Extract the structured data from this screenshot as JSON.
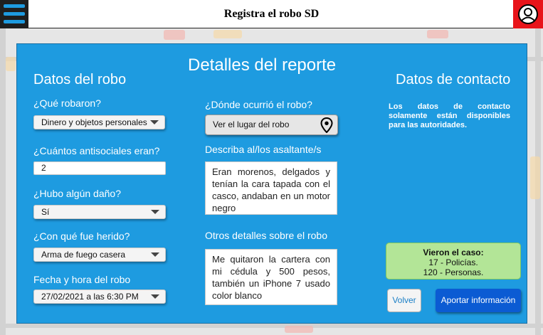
{
  "header": {
    "title": "Registra el robo SD"
  },
  "form": {
    "title": "Detalles del reporte",
    "robbery_section": {
      "title": "Datos del robo"
    },
    "what_stolen": {
      "label": "¿Qué robaron?",
      "value": "Dinero y objetos personales"
    },
    "how_many": {
      "label": "¿Cuántos antisociales eran?",
      "value": "2"
    },
    "damage": {
      "label": "¿Hubo algún daño?",
      "value": "Sí"
    },
    "weapon": {
      "label": "¿Con qué fue herido?",
      "value": "Arma de fuego casera"
    },
    "datetime": {
      "label": "Fecha y hora del robo",
      "value": "27/02/2021 a las 6:30 PM"
    },
    "location": {
      "label": "¿Dónde ocurrió el robo?",
      "button": "Ver el lugar del robo",
      "icon": "map-pin-icon"
    },
    "assailants": {
      "label": "Describa al/los asaltante/s",
      "value": "Eran morenos, delgados y tenían la cara tapada con el casco, andaban en un motor negro"
    },
    "other": {
      "label": "Otros detalles sobre el robo",
      "value": "Me quitaron la cartera con mi cédula y 500 pesos, también un iPhone 7 usado color blanco"
    }
  },
  "contact": {
    "title": "Datos de contacto",
    "note": "Los datos de contacto solamente están disponibles para las autoridades."
  },
  "stats": {
    "title": "Vieron el caso:",
    "police": "17 - Policías.",
    "people": "120 - Personas."
  },
  "buttons": {
    "back": "Volver",
    "contribute": "Aportar información"
  },
  "colors": {
    "panel": "#1e9be0",
    "header_menu": "#1f1f1f",
    "user_button": "#e8141a",
    "stats_box": "#b3e597",
    "primary_button": "#0b5bd3"
  }
}
